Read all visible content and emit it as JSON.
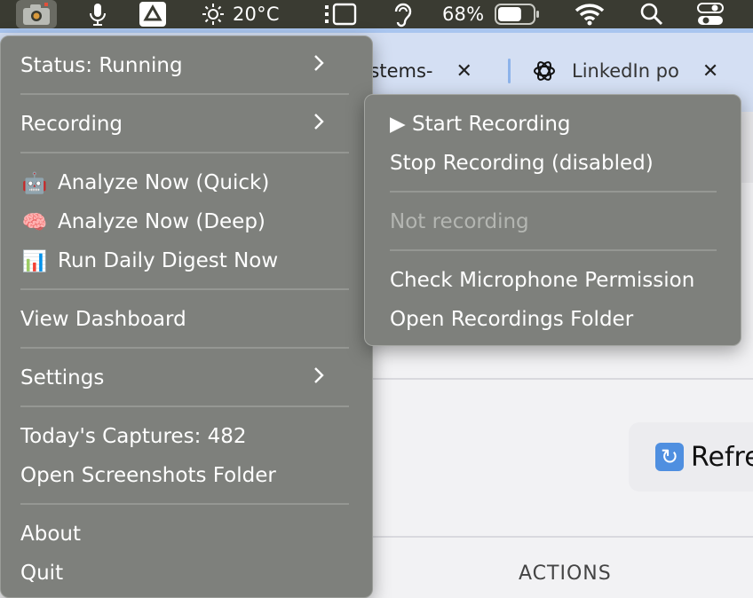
{
  "menubar": {
    "weather_temp": "20°C",
    "battery_percent": "68%",
    "battery_level": 0.68,
    "icons": [
      "app-camera-icon",
      "microphone-icon",
      "google-drive-icon",
      "sun-icon",
      "screen-mirroring-icon",
      "hearing-icon",
      "battery-icon",
      "wifi-icon",
      "search-icon",
      "control-center-icon"
    ]
  },
  "browser": {
    "tabs": [
      {
        "title": "ystems-"
      },
      {
        "title": "LinkedIn po"
      }
    ],
    "close_glyph": "✕",
    "refresh_label": "Refre",
    "actions_label": "ACTIONS"
  },
  "menu": {
    "status": "Status: Running",
    "recording": "Recording",
    "analyze_quick": {
      "emoji": "🤖",
      "label": "Analyze Now (Quick)"
    },
    "analyze_deep": {
      "emoji": "🧠",
      "label": "Analyze Now (Deep)"
    },
    "daily_digest": {
      "emoji": "📊",
      "label": "Run Daily Digest Now"
    },
    "view_dashboard": "View Dashboard",
    "settings": "Settings",
    "todays_captures": "Today's Captures: 482",
    "open_screenshots": "Open Screenshots Folder",
    "about": "About",
    "quit": "Quit"
  },
  "submenu": {
    "start_recording": "▶ Start Recording",
    "stop_recording": "Stop Recording (disabled)",
    "not_recording": "Not recording",
    "check_mic": "Check Microphone Permission",
    "open_recordings": "Open Recordings Folder"
  }
}
